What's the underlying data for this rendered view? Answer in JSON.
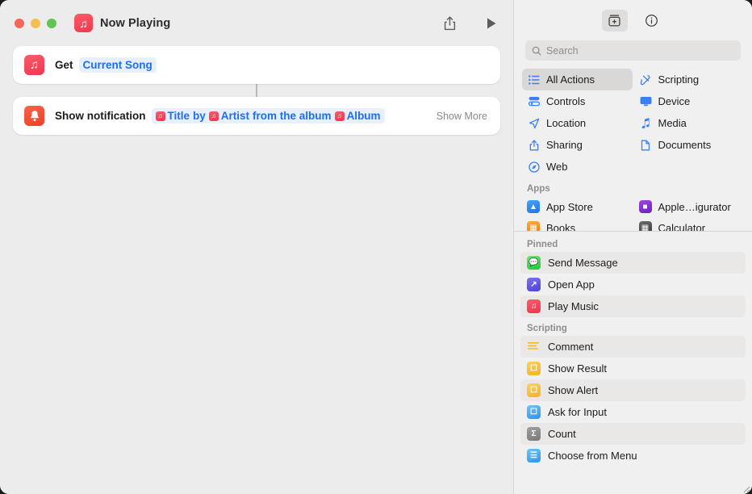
{
  "window": {
    "title": "Now Playing",
    "title_icon": "music-note-icon",
    "traffic_lights": [
      "close",
      "minimize",
      "zoom"
    ],
    "toolbar": {
      "share_label": "share-icon",
      "play_label": "play-icon"
    }
  },
  "editor": {
    "actions": [
      {
        "icon": "music-app-icon",
        "verb": "Get",
        "token": "Current Song"
      },
      {
        "icon": "notification-bell-icon",
        "verb": "Show notification",
        "tokens": [
          {
            "type": "variable",
            "badge": "music-note-badge",
            "text": "Title"
          },
          {
            "type": "plain",
            "text": "by"
          },
          {
            "type": "variable",
            "badge": "music-note-badge",
            "text": "Artist"
          },
          {
            "type": "plain",
            "text": "from the album"
          },
          {
            "type": "variable",
            "badge": "music-note-badge",
            "text": "Album"
          }
        ],
        "show_more_label": "Show More"
      }
    ]
  },
  "sidebar": {
    "toolbar": {
      "library_button": "action-library-icon",
      "info_button": "info-icon"
    },
    "search": {
      "placeholder": "Search",
      "value": "",
      "icon": "search-icon"
    },
    "categories": [
      {
        "label": "All Actions",
        "icon": "list-icon",
        "selected": true
      },
      {
        "label": "Scripting",
        "icon": "scripting-icon",
        "selected": false
      },
      {
        "label": "Controls",
        "icon": "controls-icon",
        "selected": false
      },
      {
        "label": "Device",
        "icon": "display-icon",
        "selected": false
      },
      {
        "label": "Location",
        "icon": "location-arrow-icon",
        "selected": false
      },
      {
        "label": "Media",
        "icon": "music-note-icon",
        "selected": false
      },
      {
        "label": "Sharing",
        "icon": "share-icon",
        "selected": false
      },
      {
        "label": "Documents",
        "icon": "document-icon",
        "selected": false
      },
      {
        "label": "Web",
        "icon": "compass-icon",
        "selected": false
      }
    ],
    "apps_section": {
      "label": "Apps",
      "items": [
        {
          "label": "App Store",
          "icon": "app-store-icon",
          "color": "#2b8ef5"
        },
        {
          "label": "Apple…igurator",
          "icon": "apple-configurator-icon",
          "color": "#7a2fd0"
        },
        {
          "label": "Books",
          "icon": "books-icon",
          "color": "#f59321"
        },
        {
          "label": "Calculator",
          "icon": "calculator-icon",
          "color": "#4c4c4c"
        }
      ]
    },
    "pinned_section": {
      "label": "Pinned",
      "items": [
        {
          "label": "Send Message",
          "icon": "messages-icon",
          "color": "#4cd85a"
        },
        {
          "label": "Open App",
          "icon": "open-app-icon",
          "color": "#5a55e0"
        },
        {
          "label": "Play Music",
          "icon": "music-app-icon",
          "color": "#f4465c"
        }
      ]
    },
    "scripting_section": {
      "label": "Scripting",
      "items": [
        {
          "label": "Comment",
          "icon": "comment-icon",
          "color": "#f5c242"
        },
        {
          "label": "Show Result",
          "icon": "show-result-icon",
          "color": "#f5c242"
        },
        {
          "label": "Show Alert",
          "icon": "show-alert-icon",
          "color": "#f5c242"
        },
        {
          "label": "Ask for Input",
          "icon": "ask-input-icon",
          "color": "#4aa8f0"
        },
        {
          "label": "Count",
          "icon": "count-sigma-icon",
          "color": "#8a8a8a"
        },
        {
          "label": "Choose from Menu",
          "icon": "choose-menu-icon",
          "color": "#4aa8f0"
        }
      ]
    }
  },
  "colors": {
    "accent_blue": "#1b6ef5",
    "music_red": "#ef3550",
    "notify_orange": "#ec4026"
  }
}
